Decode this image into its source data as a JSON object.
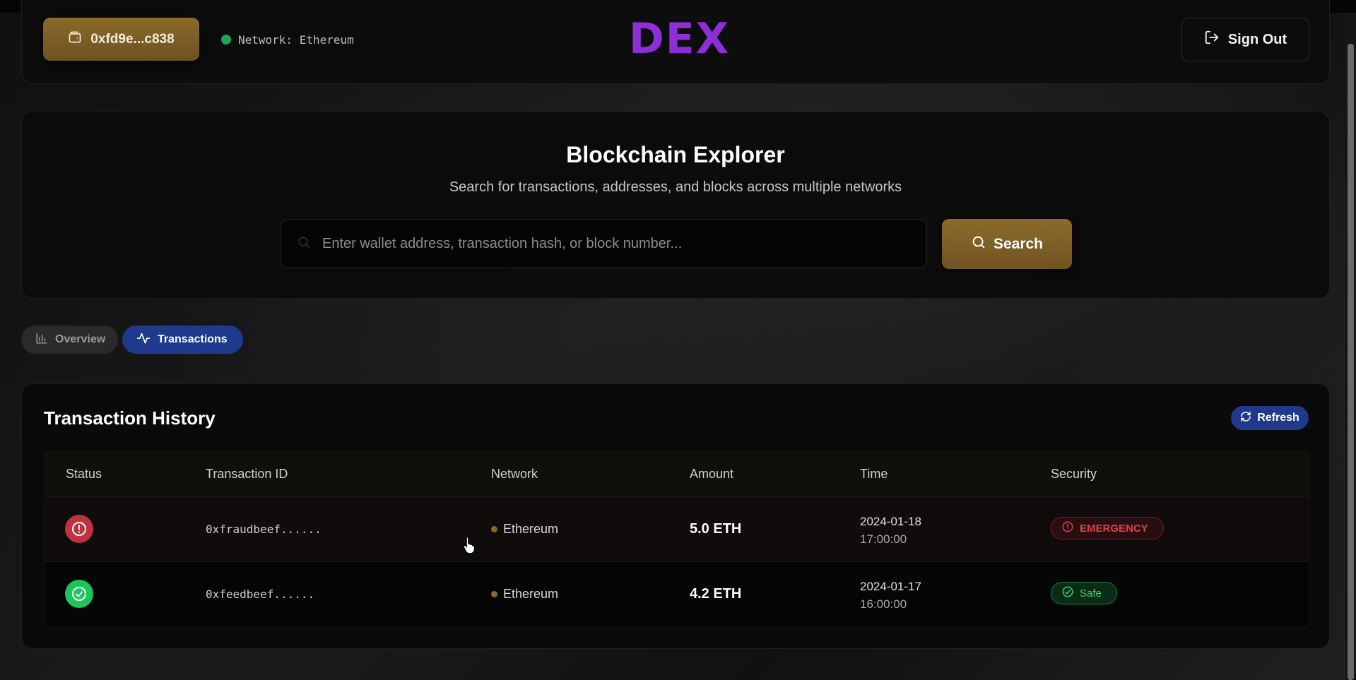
{
  "header": {
    "wallet_label": "0xfd9e...c838",
    "network_status": "Network: Ethereum",
    "logo": "DEX",
    "sign_out_label": "Sign Out"
  },
  "explorer": {
    "title": "Blockchain Explorer",
    "subtitle": "Search for transactions, addresses, and blocks across multiple networks",
    "search_placeholder": "Enter wallet address, transaction hash, or block number...",
    "search_value": "",
    "search_button": "Search"
  },
  "tabs": [
    {
      "label": "Overview",
      "icon": "bar-chart-icon",
      "active": false
    },
    {
      "label": "Transactions",
      "icon": "activity-icon",
      "active": true
    }
  ],
  "history": {
    "title": "Transaction History",
    "refresh_label": "Refresh",
    "columns": [
      "Status",
      "Transaction ID",
      "Network",
      "Amount",
      "Time",
      "Security"
    ],
    "rows": [
      {
        "status": "alert",
        "tx_id": "0xfraudbeef......",
        "network": "Ethereum",
        "amount": "5.0 ETH",
        "date": "2024-01-18",
        "time": "17:00:00",
        "security": "EMERGENCY"
      },
      {
        "status": "success",
        "tx_id": "0xfeedbeef......",
        "network": "Ethereum",
        "amount": "4.2 ETH",
        "date": "2024-01-17",
        "time": "16:00:00",
        "security": "Safe"
      }
    ]
  },
  "colors": {
    "accent_gold": "#8a6a2a",
    "accent_blue": "#1f3a8c",
    "logo_purple": "#8d2fd6",
    "danger": "#c0323f",
    "success": "#1ec65a"
  }
}
